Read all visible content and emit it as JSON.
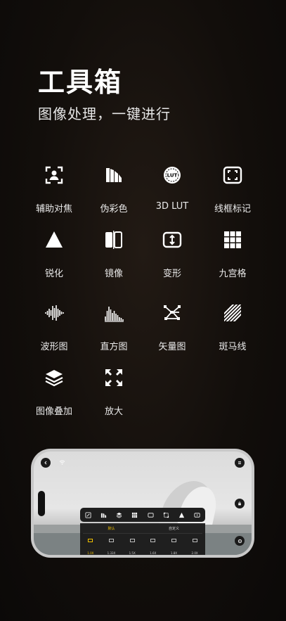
{
  "header": {
    "title": "工具箱",
    "subtitle": "图像处理，一键进行"
  },
  "tools": [
    {
      "label": "辅助对焦",
      "icon": "focus-assist-icon"
    },
    {
      "label": "伪彩色",
      "icon": "false-color-icon"
    },
    {
      "label": "3D LUT",
      "icon": "lut-icon"
    },
    {
      "label": "线框标记",
      "icon": "frame-marker-icon"
    },
    {
      "label": "锐化",
      "icon": "sharpen-icon"
    },
    {
      "label": "镜像",
      "icon": "mirror-icon"
    },
    {
      "label": "变形",
      "icon": "anamorphic-icon"
    },
    {
      "label": "九宫格",
      "icon": "grid-icon"
    },
    {
      "label": "波形图",
      "icon": "waveform-icon"
    },
    {
      "label": "直方图",
      "icon": "histogram-icon"
    },
    {
      "label": "矢量图",
      "icon": "vectorscope-icon"
    },
    {
      "label": "斑马线",
      "icon": "zebra-icon"
    },
    {
      "label": "图像叠加",
      "icon": "overlay-icon"
    },
    {
      "label": "放大",
      "icon": "zoom-icon"
    }
  ],
  "phone": {
    "lut_badge": "LUT",
    "panel_tabs": [
      "默认",
      "自定义"
    ],
    "active_tab": 0,
    "presets": [
      "1.0X",
      "1.33X",
      "1.5X",
      "1.6X",
      "1.8X",
      "2.0X"
    ],
    "selected_preset": 0,
    "accent": "#f2c200"
  }
}
